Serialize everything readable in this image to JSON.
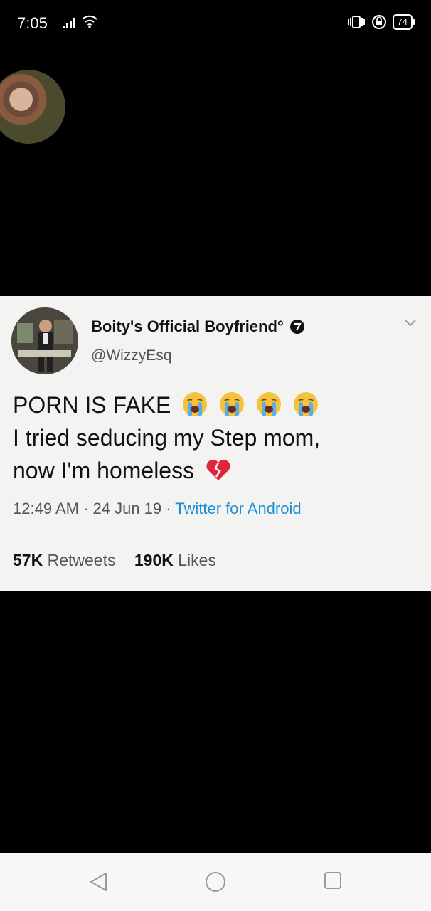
{
  "status_bar": {
    "time": "7:05",
    "battery": "74"
  },
  "tweet": {
    "display_name": "Boity's Official Boyfriend",
    "name_suffix": "°",
    "handle": "@WizzyEsq",
    "line1": "PORN IS FAKE",
    "line2": "I tried seducing my Step mom,",
    "line3": "now I'm homeless",
    "timestamp": "12:49 AM · 24 Jun 19 · ",
    "source": "Twitter for Android",
    "retweets_count": "57K",
    "retweets_label": "Retweets",
    "likes_count": "190K",
    "likes_label": "Likes",
    "emojis": [
      "crying-face",
      "crying-face",
      "crying-face",
      "crying-face",
      "broken-heart"
    ]
  },
  "nav": {
    "buttons": [
      "back-icon",
      "home-icon",
      "recents-icon"
    ]
  },
  "colors": {
    "link": "#1b8fd6",
    "tweet_bg": "#f3f4f2",
    "page_bg": "#000000"
  }
}
